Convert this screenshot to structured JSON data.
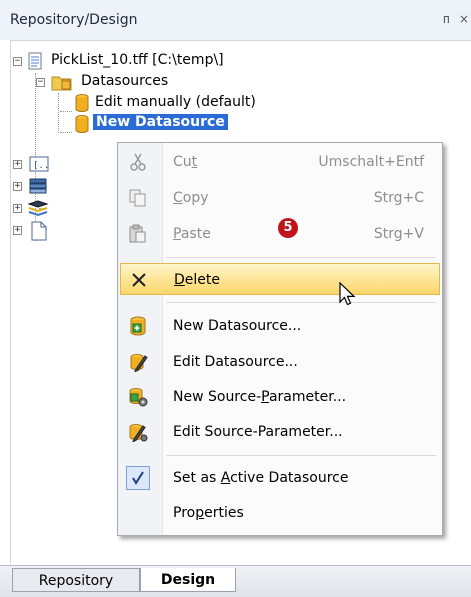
{
  "panel": {
    "title": "Repository/Design",
    "pin_glyph": "ᴨ",
    "close_glyph": "×"
  },
  "tree": {
    "root_label": "PickList_10.tff [C:\\temp\\]",
    "datasources_label": "Datasources",
    "edit_manually_label": "Edit manually (default)",
    "new_datasource_label": "New Datasource"
  },
  "menu": {
    "cut": {
      "label_pre": "Cu",
      "label_u": "t",
      "label_post": "",
      "shortcut": "Umschalt+Entf"
    },
    "copy": {
      "label_pre": "",
      "label_u": "C",
      "label_post": "opy",
      "shortcut": "Strg+C"
    },
    "paste": {
      "label_pre": "",
      "label_u": "P",
      "label_post": "aste",
      "shortcut": "Strg+V"
    },
    "delete": {
      "label_pre": "",
      "label_u": "D",
      "label_post": "elete"
    },
    "new_datasource": "New Datasource...",
    "edit_datasource": "Edit Datasource...",
    "new_source_param": {
      "label_pre": "New Source-",
      "label_u": "P",
      "label_post": "arameter..."
    },
    "edit_source_param": "Edit Source-Parameter...",
    "set_active": {
      "label_pre": "Set as ",
      "label_u": "A",
      "label_post": "ctive Datasource"
    },
    "properties": {
      "label_pre": "Pro",
      "label_u": "p",
      "label_post": "erties"
    }
  },
  "badge": "5",
  "tabs": {
    "repository": "Repository",
    "design": "Design"
  },
  "colors": {
    "selection": "#2a6bd6",
    "highlight": "#fbd66a",
    "badge": "#c0141d"
  }
}
